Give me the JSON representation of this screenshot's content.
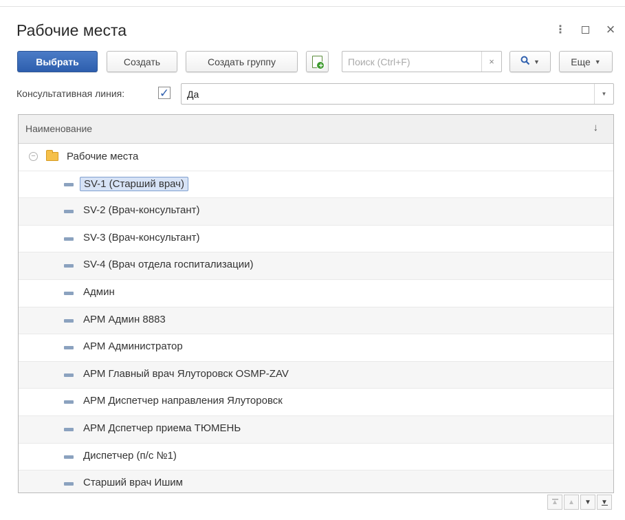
{
  "window": {
    "title": "Рабочие места"
  },
  "toolbar": {
    "select_label": "Выбрать",
    "create_label": "Создать",
    "create_group_label": "Создать группу",
    "search_placeholder": "Поиск (Ctrl+F)",
    "search_clear": "×",
    "find_icon": "search-icon",
    "more_label": "Еще"
  },
  "filter": {
    "label": "Консультативная линия:",
    "checked": true,
    "value": "Да"
  },
  "table": {
    "header": "Наименование",
    "sort_indicator": "↓",
    "group": {
      "label": "Рабочие места",
      "expanded": true
    },
    "items": [
      {
        "label": "SV-1 (Старший врач)",
        "selected": true
      },
      {
        "label": "SV-2 (Врач-консультант)"
      },
      {
        "label": "SV-3 (Врач-консультант)"
      },
      {
        "label": "SV-4 (Врач отдела госпитализации)"
      },
      {
        "label": "Админ"
      },
      {
        "label": "АРМ Админ 8883"
      },
      {
        "label": "АРМ Администратор"
      },
      {
        "label": "АРМ Главный врач Ялуторовск OSMP-ZAV"
      },
      {
        "label": "АРМ Диспетчер направления Ялуторовск"
      },
      {
        "label": "АРМ Дспетчер приема ТЮМЕНЬ"
      },
      {
        "label": "Диспетчер (п/с №1)"
      },
      {
        "label": "Старший врач Ишим"
      }
    ]
  },
  "colors": {
    "primary": "#2e5fae",
    "folder": "#f5c04a",
    "selection": "#d7e3f6"
  }
}
